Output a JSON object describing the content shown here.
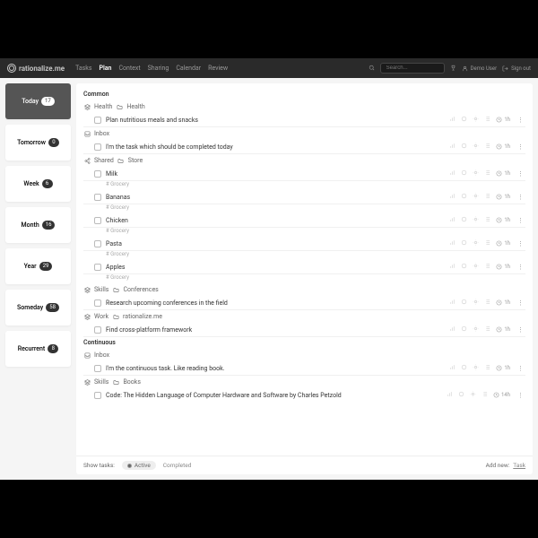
{
  "brand": "rationalize.me",
  "nav": {
    "tasks": "Tasks",
    "plan": "Plan",
    "context": "Context",
    "sharing": "Sharing",
    "calendar": "Calendar",
    "review": "Review"
  },
  "search": {
    "placeholder": "Search..."
  },
  "user": {
    "name": "Demo User",
    "signout": "Sign out"
  },
  "periods": [
    {
      "label": "Today",
      "count": "17",
      "active": true
    },
    {
      "label": "Tomorrow",
      "count": "0"
    },
    {
      "label": "Week",
      "count": "6"
    },
    {
      "label": "Month",
      "count": "16"
    },
    {
      "label": "Year",
      "count": "29"
    },
    {
      "label": "Someday",
      "count": "58"
    },
    {
      "label": "Recurrent",
      "count": "8"
    }
  ],
  "sections": {
    "common": {
      "title": "Common",
      "groups": [
        {
          "path": [
            "Health",
            "Health"
          ],
          "icon": "layers",
          "tasks": [
            {
              "title": "Plan nutritious meals and snacks",
              "dur": "1h"
            }
          ]
        },
        {
          "path": [
            "Inbox"
          ],
          "icon": "inbox",
          "tasks": [
            {
              "title": "I'm the task which should be completed today",
              "dur": "1h"
            }
          ]
        },
        {
          "path": [
            "Shared",
            "Store"
          ],
          "icon": "share",
          "tasks": [
            {
              "title": "Milk",
              "tag": "# Grocery",
              "dur": "1h"
            },
            {
              "title": "Bananas",
              "tag": "# Grocery",
              "dur": "1h"
            },
            {
              "title": "Chicken",
              "tag": "# Grocery",
              "dur": "1h"
            },
            {
              "title": "Pasta",
              "tag": "# Grocery",
              "dur": "1h"
            },
            {
              "title": "Apples",
              "tag": "# Grocery",
              "dur": "1h"
            }
          ]
        },
        {
          "path": [
            "Skills",
            "Conferences"
          ],
          "icon": "layers",
          "tasks": [
            {
              "title": "Research upcoming conferences in the field",
              "dur": "1h"
            }
          ]
        },
        {
          "path": [
            "Work",
            "rationalize.me"
          ],
          "icon": "layers",
          "tasks": [
            {
              "title": "Find cross-platform framework",
              "dur": "1h"
            }
          ]
        }
      ]
    },
    "continuous": {
      "title": "Continuous",
      "groups": [
        {
          "path": [
            "Inbox"
          ],
          "icon": "inbox",
          "tasks": [
            {
              "title": "I'm the continuous task. Like reading book.",
              "dur": "1h"
            }
          ]
        },
        {
          "path": [
            "Skills",
            "Books"
          ],
          "icon": "layers",
          "tasks": [
            {
              "title": "Code: The Hidden Language of Computer Hardware and Software by Charles Petzold",
              "dur": "14h"
            }
          ]
        }
      ]
    }
  },
  "footer": {
    "show": "Show tasks:",
    "active": "Active",
    "completed": "Completed",
    "addnew": "Add new:",
    "task": "Task"
  }
}
